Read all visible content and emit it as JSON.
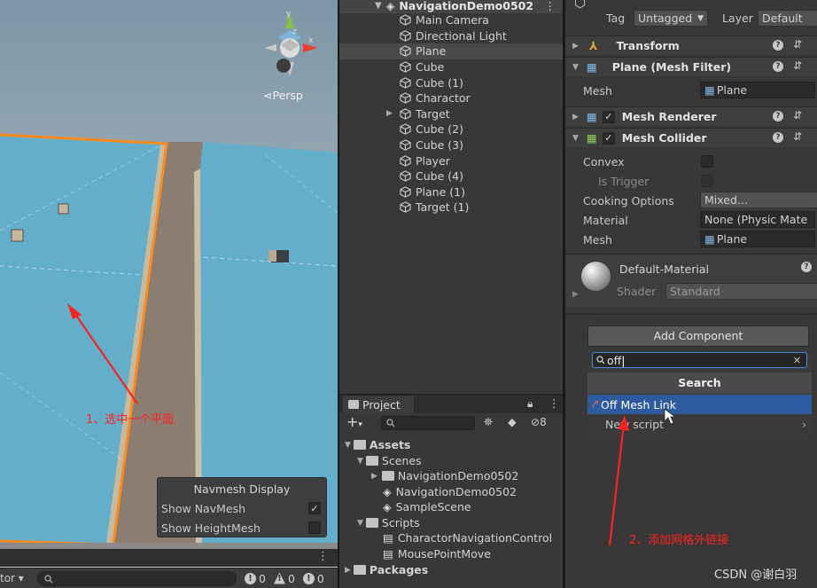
{
  "scene": {
    "persp_label": "Persp",
    "annotation": "1、选中一个平面",
    "navmesh_display": {
      "title": "Navmesh Display",
      "show_navmesh": "Show NavMesh",
      "show_heightmesh": "Show HeightMesh"
    },
    "toolbar": {
      "dropdown_label": "tor",
      "errors": "0",
      "warnings": "0",
      "infos": "0"
    }
  },
  "hierarchy": {
    "scene_name": "NavigationDemo0502",
    "items": [
      {
        "label": "Main Camera"
      },
      {
        "label": "Directional Light"
      },
      {
        "label": "Plane"
      },
      {
        "label": "Cube"
      },
      {
        "label": "Cube (1)"
      },
      {
        "label": "Charactor"
      },
      {
        "label": "Target"
      },
      {
        "label": "Cube (2)"
      },
      {
        "label": "Cube (3)"
      },
      {
        "label": "Player"
      },
      {
        "label": "Cube (4)"
      },
      {
        "label": "Plane (1)"
      },
      {
        "label": "Target (1)"
      }
    ]
  },
  "project": {
    "tab_label": "Project",
    "hidden_count": "8",
    "tree": {
      "assets": "Assets",
      "scenes": "Scenes",
      "scene_folder": "NavigationDemo0502",
      "scene_file": "NavigationDemo0502",
      "sample_scene": "SampleScene",
      "scripts": "Scripts",
      "script1": "CharactorNavigationControl",
      "script2": "MousePointMove",
      "packages": "Packages"
    }
  },
  "inspector": {
    "tag_label": "Tag",
    "tag_value": "Untagged",
    "layer_label": "Layer",
    "layer_value": "Default",
    "transform": "Transform",
    "mesh_filter": "Plane (Mesh Filter)",
    "mesh_label": "Mesh",
    "mesh_value": "Plane",
    "mesh_renderer": "Mesh Renderer",
    "mesh_collider": "Mesh Collider",
    "convex": "Convex",
    "is_trigger": "Is Trigger",
    "cooking_options": "Cooking Options",
    "cooking_value": "Mixed...",
    "material_label": "Material",
    "material_value": "None (Physic Mate",
    "collider_mesh_label": "Mesh",
    "collider_mesh_value": "Plane",
    "material_name": "Default-Material",
    "shader_label": "Shader",
    "shader_value": "Standard",
    "add_component": "Add Component",
    "search_value": "off",
    "search_title": "Search",
    "result": "Off Mesh Link",
    "new_script": "New script",
    "annotation": "2、添加网格外链接"
  },
  "watermark": "CSDN @谢白羽"
}
